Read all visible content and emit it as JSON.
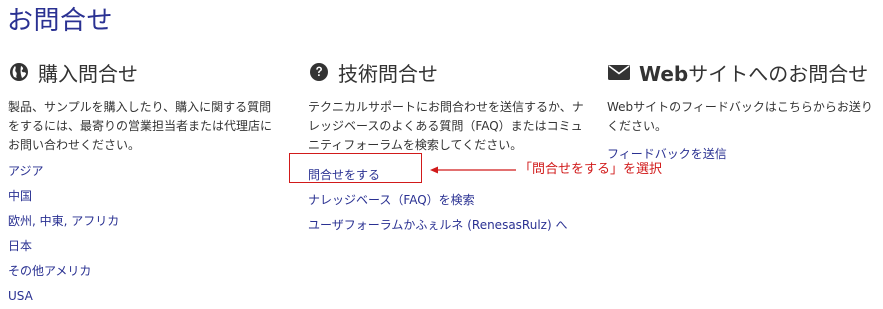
{
  "page_title": "お問合せ",
  "colors": {
    "title": "#2a3192",
    "link": "#2a3192",
    "text": "#333333",
    "annotation": "#d11a1a"
  },
  "purchase": {
    "icon": "globe-icon",
    "heading": "購入問合せ",
    "description": "製品、サンプルを購入したり、購入に関する質問をするには、最寄りの営業担当者または代理店にお問い合わせください。",
    "links": [
      "アジア",
      "中国",
      "欧州, 中東, アフリカ",
      "日本",
      "その他アメリカ",
      "USA"
    ]
  },
  "technical": {
    "icon": "question-circle-icon",
    "heading": "技術問合せ",
    "description": "テクニカルサポートにお問合わせを送信するか、ナレッジベースのよくある質問（FAQ）またはコミュニティフォーラムを検索してください。",
    "links": [
      "問合せをする",
      "ナレッジベース（FAQ）を検索",
      "ユーザフォーラムかふぇルネ (RenesasRulz) へ"
    ]
  },
  "website": {
    "icon": "envelope-icon",
    "heading_bold": "Web",
    "heading_rest": "サイトへのお問合せ",
    "description": "Webサイトのフィードバックはこちらからお送りください。",
    "links": [
      "フィードバックを送信"
    ]
  },
  "annotation": {
    "text": "「問合せをする」を選択"
  }
}
